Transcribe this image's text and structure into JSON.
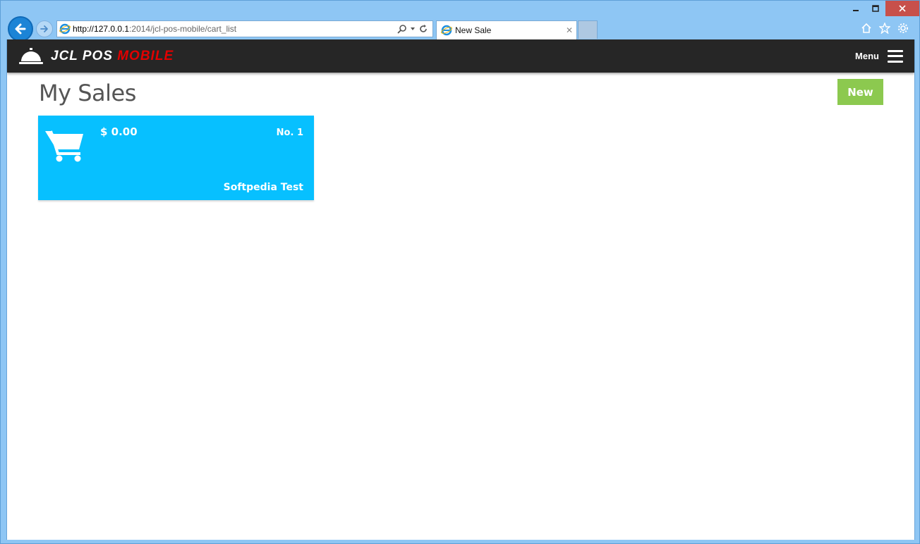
{
  "browser": {
    "url_host": "http://127.0.0.1",
    "url_rest": ":2014/jcl-pos-mobile/cart_list",
    "tab_title": "New Sale"
  },
  "app": {
    "brand_main": "JCL POS ",
    "brand_accent": "MOBILE",
    "menu_label": "Menu"
  },
  "page": {
    "title": "My Sales",
    "new_button": "New"
  },
  "carts": [
    {
      "amount": "$ 0.00",
      "number": "No. 1",
      "customer": "Softpedia Test"
    }
  ],
  "colors": {
    "header_bg": "#262626",
    "brand_accent": "#e20000",
    "card_bg": "#07c0ff",
    "new_button_bg": "#8cc94f"
  }
}
